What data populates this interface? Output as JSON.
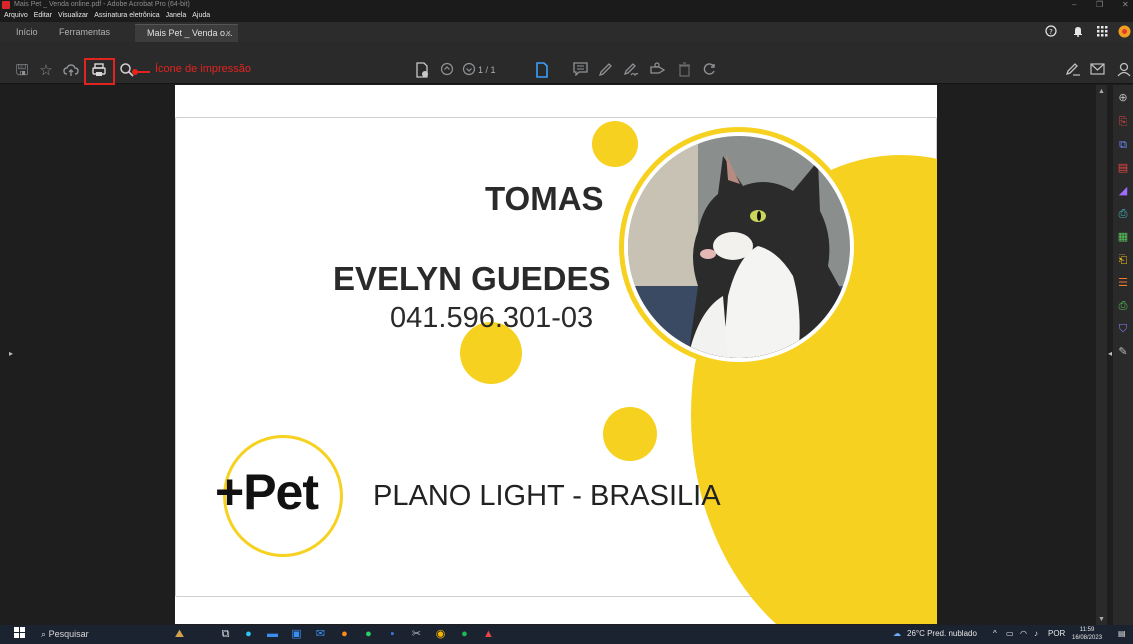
{
  "window": {
    "title": "Mais Pet _ Venda online.pdf - Adobe Acrobat Pro (64-bit)",
    "controls": [
      "–",
      "❐",
      "✕"
    ]
  },
  "menu": [
    "Arquivo",
    "Editar",
    "Visualizar",
    "Assinatura eletrônica",
    "Janela",
    "Ajuda"
  ],
  "tabs": {
    "home": "Início",
    "tools": "Ferramentas",
    "doc": "Mais Pet _ Venda o...",
    "close": "×"
  },
  "toolbar": {
    "annotation": "Ícone de impressão",
    "page_current": "1",
    "page_total": "/ 1",
    "accent": "#3aa0ff",
    "annotation_color": "#e3231f"
  },
  "card": {
    "pet_name": "TOMAS",
    "owner_name": "EVELYN GUEDES",
    "cpf": "041.596.301-03",
    "plan": "PLANO LIGHT - BRASILIA",
    "logo": "+Pet",
    "brand_color": "#f7d120"
  },
  "taskbar": {
    "search_placeholder": "Pesquisar",
    "weather": "26°C  Pred. nublado",
    "language": "POR",
    "time": "11:59",
    "date": "16/08/2023"
  }
}
